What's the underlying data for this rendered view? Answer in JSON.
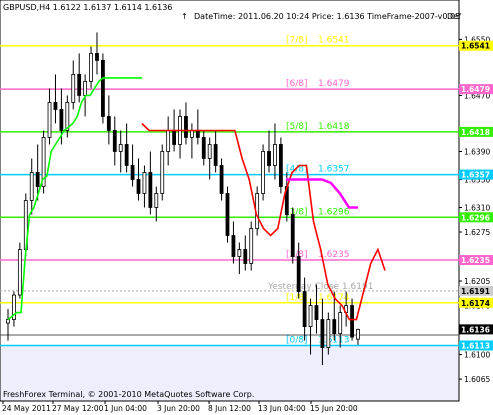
{
  "window": {
    "symbol_ohlc": "GBPUSD,H4  1.6122 1.6137 1.6114 1.6136",
    "arrow_glyph": "↑",
    "info": "DateTime: 2011.06.20 10:24    Price: 1.6136    TimeFrame-2007-v0.05",
    "truncated": "Def",
    "copyright": "FreshForex Terminal, © 2001-2010 MetaQuotes Software Corp.",
    "yesterday_label": "Yesterday Close 1.6191"
  },
  "colors": {
    "background": "#ffffff",
    "lower_band": "#eeeefc",
    "candles": "#000000",
    "green_line": "#00ff00",
    "red_line": "#ff0000",
    "magenta_line": "#ff00ff",
    "yellow": "#ffff00",
    "pink": "#ff66cc",
    "green_level": "#33ee00",
    "cyan": "#00ccff",
    "gray_line": "#aaaaaa",
    "current_tag": "#000000"
  },
  "y_axis": {
    "labels": [
      "1.6550",
      "1.6470",
      "1.6390",
      "1.6350",
      "1.6310",
      "1.6275",
      "1.6205",
      "1.6170",
      "1.6100",
      "1.6065"
    ],
    "values": [
      1.655,
      1.647,
      1.639,
      1.635,
      1.631,
      1.6275,
      1.6205,
      1.617,
      1.61,
      1.6065
    ],
    "min": 1.6058,
    "max": 1.6572
  },
  "x_axis": {
    "labels": [
      "24 May 2011",
      "27 May 12:00",
      "1 Jun 04:00",
      "3 Jun 20:00",
      "8 Jun 12:00",
      "13 Jun 04:00",
      "15 Jun 20:00"
    ]
  },
  "murrey_levels": [
    {
      "fraction": "[7/8]",
      "value": "1.6541",
      "price": 1.6541,
      "color": "#ffff00",
      "tag": "1.6541"
    },
    {
      "fraction": "[6/8]",
      "value": "1.6479",
      "price": 1.6479,
      "color": "#ff66cc",
      "tag": "1.6479"
    },
    {
      "fraction": "[5/8]",
      "value": "1.6418",
      "price": 1.6418,
      "color": "#33ee00",
      "tag": "1.6418"
    },
    {
      "fraction": "[4/8]",
      "value": "1.6357",
      "price": 1.6357,
      "color": "#00ccff",
      "tag": "1.6357"
    },
    {
      "fraction": "[3/8]",
      "value": "1.6296",
      "price": 1.6296,
      "color": "#33ee00",
      "tag": "1.6296"
    },
    {
      "fraction": "[2/8]",
      "value": "1.6235",
      "price": 1.6235,
      "color": "#ff66cc",
      "tag": "1.6235"
    },
    {
      "fraction": "[1/8]",
      "value": "1.6174",
      "price": 1.6174,
      "color": "#ffff00",
      "tag": "1.6174"
    },
    {
      "fraction": "[0/8]",
      "value": "1.6113",
      "price": 1.6113,
      "color": "#00ccff",
      "tag": "1.6113"
    }
  ],
  "yesterday_close": {
    "price": 1.6191,
    "tag": "1.6191"
  },
  "current_price": {
    "price": 1.6136,
    "tag": "1.6136"
  },
  "chart_data": {
    "type": "line",
    "series": [
      {
        "values": [
          1.615,
          1.6155,
          1.616,
          1.616,
          1.624,
          1.63,
          1.631,
          1.633,
          1.635,
          1.6355,
          1.639,
          1.64,
          1.641,
          1.642,
          1.6425,
          1.643,
          1.644,
          1.646,
          1.647,
          1.647,
          1.648,
          1.649,
          1.6495,
          1.6495,
          1.6495,
          1.6495,
          1.6495,
          1.6495,
          1.6495,
          1.6495,
          1.6495,
          1.6495
        ]
      },
      {
        "values": [
          1.643,
          1.642,
          1.642,
          1.642,
          1.642,
          1.642,
          1.642,
          1.642,
          1.642,
          1.642,
          1.642,
          1.642,
          1.642,
          1.642,
          1.638,
          1.635,
          1.63,
          1.628,
          1.627,
          1.628,
          1.633,
          1.636,
          1.637,
          1.637,
          1.629,
          1.625,
          1.62,
          1.618,
          1.617,
          1.615,
          1.615,
          1.619,
          1.623,
          1.625,
          1.622
        ]
      },
      {
        "values": [
          1.635,
          1.635,
          1.635,
          1.635,
          1.635,
          1.6345,
          1.633,
          1.631,
          1.631
        ]
      }
    ],
    "candles": [
      {
        "o": 1.6145,
        "h": 1.6165,
        "l": 1.612,
        "c": 1.615
      },
      {
        "o": 1.615,
        "h": 1.619,
        "l": 1.614,
        "c": 1.6185
      },
      {
        "o": 1.6185,
        "h": 1.626,
        "l": 1.618,
        "c": 1.625
      },
      {
        "o": 1.625,
        "h": 1.633,
        "l": 1.624,
        "c": 1.632
      },
      {
        "o": 1.632,
        "h": 1.638,
        "l": 1.63,
        "c": 1.636
      },
      {
        "o": 1.636,
        "h": 1.64,
        "l": 1.632,
        "c": 1.634
      },
      {
        "o": 1.634,
        "h": 1.642,
        "l": 1.633,
        "c": 1.641
      },
      {
        "o": 1.641,
        "h": 1.648,
        "l": 1.64,
        "c": 1.646
      },
      {
        "o": 1.646,
        "h": 1.65,
        "l": 1.643,
        "c": 1.645
      },
      {
        "o": 1.645,
        "h": 1.648,
        "l": 1.64,
        "c": 1.642
      },
      {
        "o": 1.642,
        "h": 1.647,
        "l": 1.641,
        "c": 1.646
      },
      {
        "o": 1.646,
        "h": 1.652,
        "l": 1.645,
        "c": 1.65
      },
      {
        "o": 1.65,
        "h": 1.653,
        "l": 1.646,
        "c": 1.647
      },
      {
        "o": 1.647,
        "h": 1.65,
        "l": 1.644,
        "c": 1.649
      },
      {
        "o": 1.649,
        "h": 1.654,
        "l": 1.648,
        "c": 1.653
      },
      {
        "o": 1.653,
        "h": 1.656,
        "l": 1.65,
        "c": 1.652
      },
      {
        "o": 1.652,
        "h": 1.653,
        "l": 1.643,
        "c": 1.644
      },
      {
        "o": 1.644,
        "h": 1.647,
        "l": 1.64,
        "c": 1.642
      },
      {
        "o": 1.642,
        "h": 1.644,
        "l": 1.637,
        "c": 1.639
      },
      {
        "o": 1.639,
        "h": 1.642,
        "l": 1.636,
        "c": 1.64
      },
      {
        "o": 1.64,
        "h": 1.643,
        "l": 1.636,
        "c": 1.637
      },
      {
        "o": 1.637,
        "h": 1.64,
        "l": 1.634,
        "c": 1.635
      },
      {
        "o": 1.635,
        "h": 1.638,
        "l": 1.632,
        "c": 1.633
      },
      {
        "o": 1.633,
        "h": 1.637,
        "l": 1.631,
        "c": 1.636
      },
      {
        "o": 1.636,
        "h": 1.639,
        "l": 1.63,
        "c": 1.631
      },
      {
        "o": 1.631,
        "h": 1.634,
        "l": 1.629,
        "c": 1.633
      },
      {
        "o": 1.633,
        "h": 1.64,
        "l": 1.632,
        "c": 1.639
      },
      {
        "o": 1.639,
        "h": 1.644,
        "l": 1.637,
        "c": 1.642
      },
      {
        "o": 1.642,
        "h": 1.645,
        "l": 1.639,
        "c": 1.64
      },
      {
        "o": 1.64,
        "h": 1.645,
        "l": 1.638,
        "c": 1.644
      },
      {
        "o": 1.644,
        "h": 1.646,
        "l": 1.64,
        "c": 1.641
      },
      {
        "o": 1.641,
        "h": 1.643,
        "l": 1.638,
        "c": 1.642
      },
      {
        "o": 1.642,
        "h": 1.645,
        "l": 1.64,
        "c": 1.641
      },
      {
        "o": 1.641,
        "h": 1.642,
        "l": 1.637,
        "c": 1.638
      },
      {
        "o": 1.638,
        "h": 1.641,
        "l": 1.635,
        "c": 1.64
      },
      {
        "o": 1.64,
        "h": 1.642,
        "l": 1.636,
        "c": 1.637
      },
      {
        "o": 1.637,
        "h": 1.638,
        "l": 1.632,
        "c": 1.633
      },
      {
        "o": 1.633,
        "h": 1.634,
        "l": 1.626,
        "c": 1.627
      },
      {
        "o": 1.627,
        "h": 1.629,
        "l": 1.623,
        "c": 1.624
      },
      {
        "o": 1.624,
        "h": 1.626,
        "l": 1.6215,
        "c": 1.625
      },
      {
        "o": 1.625,
        "h": 1.627,
        "l": 1.622,
        "c": 1.623
      },
      {
        "o": 1.623,
        "h": 1.629,
        "l": 1.622,
        "c": 1.628
      },
      {
        "o": 1.628,
        "h": 1.634,
        "l": 1.627,
        "c": 1.633
      },
      {
        "o": 1.633,
        "h": 1.64,
        "l": 1.632,
        "c": 1.639
      },
      {
        "o": 1.639,
        "h": 1.642,
        "l": 1.636,
        "c": 1.637
      },
      {
        "o": 1.637,
        "h": 1.643,
        "l": 1.635,
        "c": 1.64
      },
      {
        "o": 1.64,
        "h": 1.641,
        "l": 1.633,
        "c": 1.634
      },
      {
        "o": 1.634,
        "h": 1.636,
        "l": 1.629,
        "c": 1.63
      },
      {
        "o": 1.63,
        "h": 1.631,
        "l": 1.623,
        "c": 1.624
      },
      {
        "o": 1.624,
        "h": 1.626,
        "l": 1.618,
        "c": 1.619
      },
      {
        "o": 1.619,
        "h": 1.621,
        "l": 1.612,
        "c": 1.614
      },
      {
        "o": 1.614,
        "h": 1.618,
        "l": 1.61,
        "c": 1.617
      },
      {
        "o": 1.617,
        "h": 1.62,
        "l": 1.613,
        "c": 1.615
      },
      {
        "o": 1.615,
        "h": 1.618,
        "l": 1.6085,
        "c": 1.611
      },
      {
        "o": 1.611,
        "h": 1.616,
        "l": 1.61,
        "c": 1.615
      },
      {
        "o": 1.615,
        "h": 1.619,
        "l": 1.612,
        "c": 1.613
      },
      {
        "o": 1.613,
        "h": 1.617,
        "l": 1.611,
        "c": 1.616
      },
      {
        "o": 1.616,
        "h": 1.619,
        "l": 1.614,
        "c": 1.617
      },
      {
        "o": 1.617,
        "h": 1.618,
        "l": 1.612,
        "c": 1.6125
      },
      {
        "o": 1.6122,
        "h": 1.6137,
        "l": 1.6114,
        "c": 1.6136
      }
    ]
  }
}
